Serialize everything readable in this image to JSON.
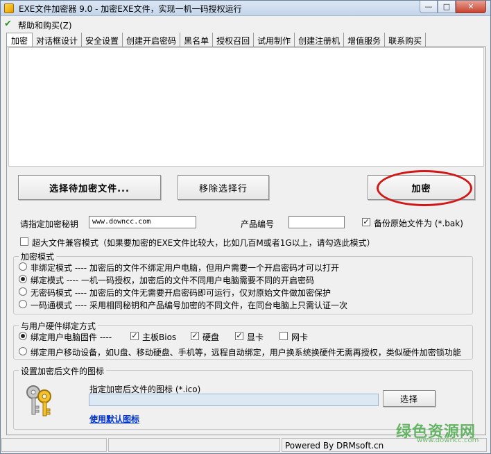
{
  "window": {
    "title": "EXE文件加密器 9.0 - 加密EXE文件，实现一机一码授权运行",
    "min": "—",
    "max": "□",
    "close": "✕"
  },
  "menu": {
    "help": "帮助和购买(Z)"
  },
  "tabs": [
    {
      "label": "加密"
    },
    {
      "label": "对话框设计"
    },
    {
      "label": "安全设置"
    },
    {
      "label": "创建开启密码"
    },
    {
      "label": "黑名单"
    },
    {
      "label": "授权召回"
    },
    {
      "label": "试用制作"
    },
    {
      "label": "创建注册机"
    },
    {
      "label": "增值服务"
    },
    {
      "label": "联系购买"
    }
  ],
  "actions": {
    "select_file": "选择待加密文件...",
    "remove_selected": "移除选择行",
    "encrypt": "加密"
  },
  "settings": {
    "secret_label": "请指定加密秘钥",
    "secret_value": "www.downcc.com",
    "product_label": "产品编号",
    "product_value": "",
    "backup_label": "备份原始文件为 (*.bak)",
    "backup_checked": "✓",
    "large_file_label": "超大文件兼容模式（如果要加密的EXE文件比较大，比如几百M或者1G以上，请勾选此模式）"
  },
  "mode_group": {
    "title": "加密模式",
    "options": [
      {
        "label": "非绑定模式 ---- 加密后的文件不绑定用户电脑，但用户需要一个开启密码才可以打开"
      },
      {
        "label": "绑定模式 ---- 一机一码授权，加密后的文件不同用户电脑需要不同的开启密码"
      },
      {
        "label": "无密码模式 ---- 加密后的文件无需要开启密码即可运行，仅对原始文件做加密保护"
      },
      {
        "label": "一码通模式 ---- 采用相同秘钥和产品编号加密的不同文件，在同台电脑上只需认证一次"
      }
    ]
  },
  "hw_group": {
    "title": "与用户硬件绑定方式",
    "bind_pc": "绑定用户电脑固件 ----",
    "mainboard": "主板Bios",
    "disk": "硬盘",
    "gpu": "显卡",
    "nic": "网卡",
    "checked": "✓",
    "bind_mobile": "绑定用户移动设备，如U盘、移动硬盘、手机等，远程自动绑定，用户换系统换硬件无需再授权，类似硬件加密锁功能"
  },
  "icon_group": {
    "title": "设置加密后文件的图标",
    "icon_label": "指定加密后文件的图标 (*.ico)",
    "icon_value": "",
    "browse": "选择",
    "default_link": "使用默认图标"
  },
  "status": {
    "seg1": "",
    "seg2": "",
    "powered": "Powered By DRMsoft.cn"
  },
  "watermark": {
    "logo": "绿色资源网",
    "url": "www.downcc.com"
  },
  "colors": {
    "highlight_oval": "#d01818",
    "link": "#0033cc"
  }
}
